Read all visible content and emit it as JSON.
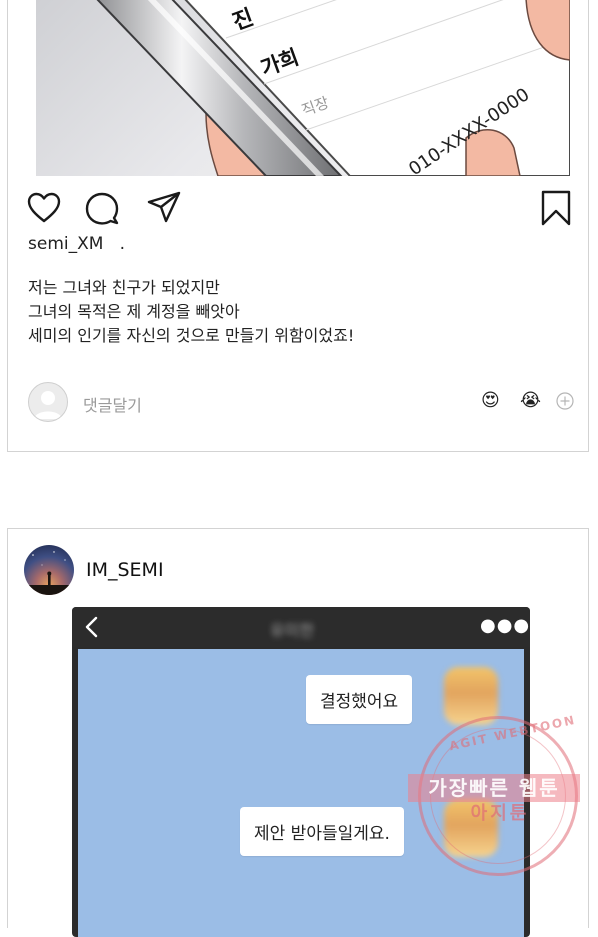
{
  "post1": {
    "image_texts": {
      "name1": "진",
      "name2": "가희",
      "field": "직장",
      "phone": "010-XXXX-0000"
    },
    "username": "semi_XM",
    "username_suffix": ".",
    "caption": [
      "저는 그녀와 친구가 되었지만",
      "그녀의 목적은 제 계정을 빼앗아",
      "세미의 인기를 자신의 것으로 만들기 위함이었죠!"
    ],
    "comment_placeholder": "댓글달기",
    "reaction_emojis": [
      "😍",
      "😭"
    ]
  },
  "post2": {
    "username": "IM_SEMI",
    "chat": {
      "title": "유미한",
      "messages": [
        "결정했어요",
        "제안 받아들일게요."
      ]
    }
  },
  "watermark": {
    "top": "AGIT WEBTOON",
    "line1": "가장빠른 웹툰",
    "line2": "아지툰"
  },
  "colors": {
    "chat_background": "#9bbde6",
    "watermark": "#e06c76"
  }
}
